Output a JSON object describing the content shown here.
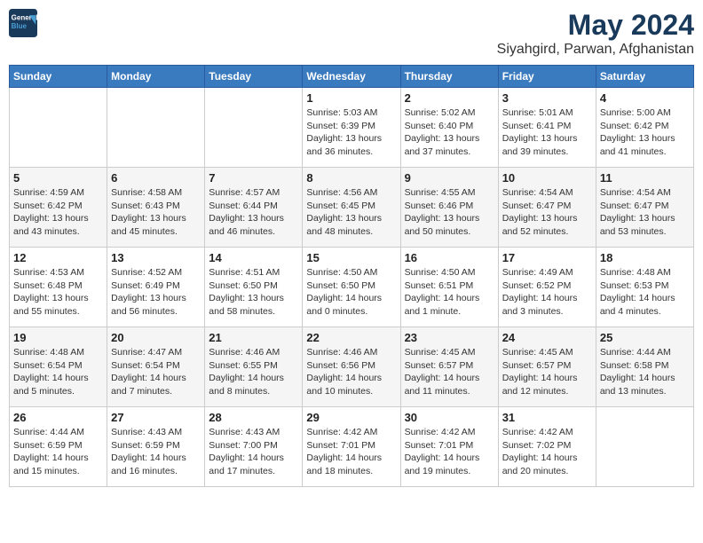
{
  "header": {
    "logo_line1": "General",
    "logo_line2": "Blue",
    "main_title": "May 2024",
    "subtitle": "Siyahgird, Parwan, Afghanistan"
  },
  "weekdays": [
    "Sunday",
    "Monday",
    "Tuesday",
    "Wednesday",
    "Thursday",
    "Friday",
    "Saturday"
  ],
  "weeks": [
    [
      {
        "day": "",
        "info": ""
      },
      {
        "day": "",
        "info": ""
      },
      {
        "day": "",
        "info": ""
      },
      {
        "day": "1",
        "info": "Sunrise: 5:03 AM\nSunset: 6:39 PM\nDaylight: 13 hours\nand 36 minutes."
      },
      {
        "day": "2",
        "info": "Sunrise: 5:02 AM\nSunset: 6:40 PM\nDaylight: 13 hours\nand 37 minutes."
      },
      {
        "day": "3",
        "info": "Sunrise: 5:01 AM\nSunset: 6:41 PM\nDaylight: 13 hours\nand 39 minutes."
      },
      {
        "day": "4",
        "info": "Sunrise: 5:00 AM\nSunset: 6:42 PM\nDaylight: 13 hours\nand 41 minutes."
      }
    ],
    [
      {
        "day": "5",
        "info": "Sunrise: 4:59 AM\nSunset: 6:42 PM\nDaylight: 13 hours\nand 43 minutes."
      },
      {
        "day": "6",
        "info": "Sunrise: 4:58 AM\nSunset: 6:43 PM\nDaylight: 13 hours\nand 45 minutes."
      },
      {
        "day": "7",
        "info": "Sunrise: 4:57 AM\nSunset: 6:44 PM\nDaylight: 13 hours\nand 46 minutes."
      },
      {
        "day": "8",
        "info": "Sunrise: 4:56 AM\nSunset: 6:45 PM\nDaylight: 13 hours\nand 48 minutes."
      },
      {
        "day": "9",
        "info": "Sunrise: 4:55 AM\nSunset: 6:46 PM\nDaylight: 13 hours\nand 50 minutes."
      },
      {
        "day": "10",
        "info": "Sunrise: 4:54 AM\nSunset: 6:47 PM\nDaylight: 13 hours\nand 52 minutes."
      },
      {
        "day": "11",
        "info": "Sunrise: 4:54 AM\nSunset: 6:47 PM\nDaylight: 13 hours\nand 53 minutes."
      }
    ],
    [
      {
        "day": "12",
        "info": "Sunrise: 4:53 AM\nSunset: 6:48 PM\nDaylight: 13 hours\nand 55 minutes."
      },
      {
        "day": "13",
        "info": "Sunrise: 4:52 AM\nSunset: 6:49 PM\nDaylight: 13 hours\nand 56 minutes."
      },
      {
        "day": "14",
        "info": "Sunrise: 4:51 AM\nSunset: 6:50 PM\nDaylight: 13 hours\nand 58 minutes."
      },
      {
        "day": "15",
        "info": "Sunrise: 4:50 AM\nSunset: 6:50 PM\nDaylight: 14 hours\nand 0 minutes."
      },
      {
        "day": "16",
        "info": "Sunrise: 4:50 AM\nSunset: 6:51 PM\nDaylight: 14 hours\nand 1 minute."
      },
      {
        "day": "17",
        "info": "Sunrise: 4:49 AM\nSunset: 6:52 PM\nDaylight: 14 hours\nand 3 minutes."
      },
      {
        "day": "18",
        "info": "Sunrise: 4:48 AM\nSunset: 6:53 PM\nDaylight: 14 hours\nand 4 minutes."
      }
    ],
    [
      {
        "day": "19",
        "info": "Sunrise: 4:48 AM\nSunset: 6:54 PM\nDaylight: 14 hours\nand 5 minutes."
      },
      {
        "day": "20",
        "info": "Sunrise: 4:47 AM\nSunset: 6:54 PM\nDaylight: 14 hours\nand 7 minutes."
      },
      {
        "day": "21",
        "info": "Sunrise: 4:46 AM\nSunset: 6:55 PM\nDaylight: 14 hours\nand 8 minutes."
      },
      {
        "day": "22",
        "info": "Sunrise: 4:46 AM\nSunset: 6:56 PM\nDaylight: 14 hours\nand 10 minutes."
      },
      {
        "day": "23",
        "info": "Sunrise: 4:45 AM\nSunset: 6:57 PM\nDaylight: 14 hours\nand 11 minutes."
      },
      {
        "day": "24",
        "info": "Sunrise: 4:45 AM\nSunset: 6:57 PM\nDaylight: 14 hours\nand 12 minutes."
      },
      {
        "day": "25",
        "info": "Sunrise: 4:44 AM\nSunset: 6:58 PM\nDaylight: 14 hours\nand 13 minutes."
      }
    ],
    [
      {
        "day": "26",
        "info": "Sunrise: 4:44 AM\nSunset: 6:59 PM\nDaylight: 14 hours\nand 15 minutes."
      },
      {
        "day": "27",
        "info": "Sunrise: 4:43 AM\nSunset: 6:59 PM\nDaylight: 14 hours\nand 16 minutes."
      },
      {
        "day": "28",
        "info": "Sunrise: 4:43 AM\nSunset: 7:00 PM\nDaylight: 14 hours\nand 17 minutes."
      },
      {
        "day": "29",
        "info": "Sunrise: 4:42 AM\nSunset: 7:01 PM\nDaylight: 14 hours\nand 18 minutes."
      },
      {
        "day": "30",
        "info": "Sunrise: 4:42 AM\nSunset: 7:01 PM\nDaylight: 14 hours\nand 19 minutes."
      },
      {
        "day": "31",
        "info": "Sunrise: 4:42 AM\nSunset: 7:02 PM\nDaylight: 14 hours\nand 20 minutes."
      },
      {
        "day": "",
        "info": ""
      }
    ]
  ]
}
